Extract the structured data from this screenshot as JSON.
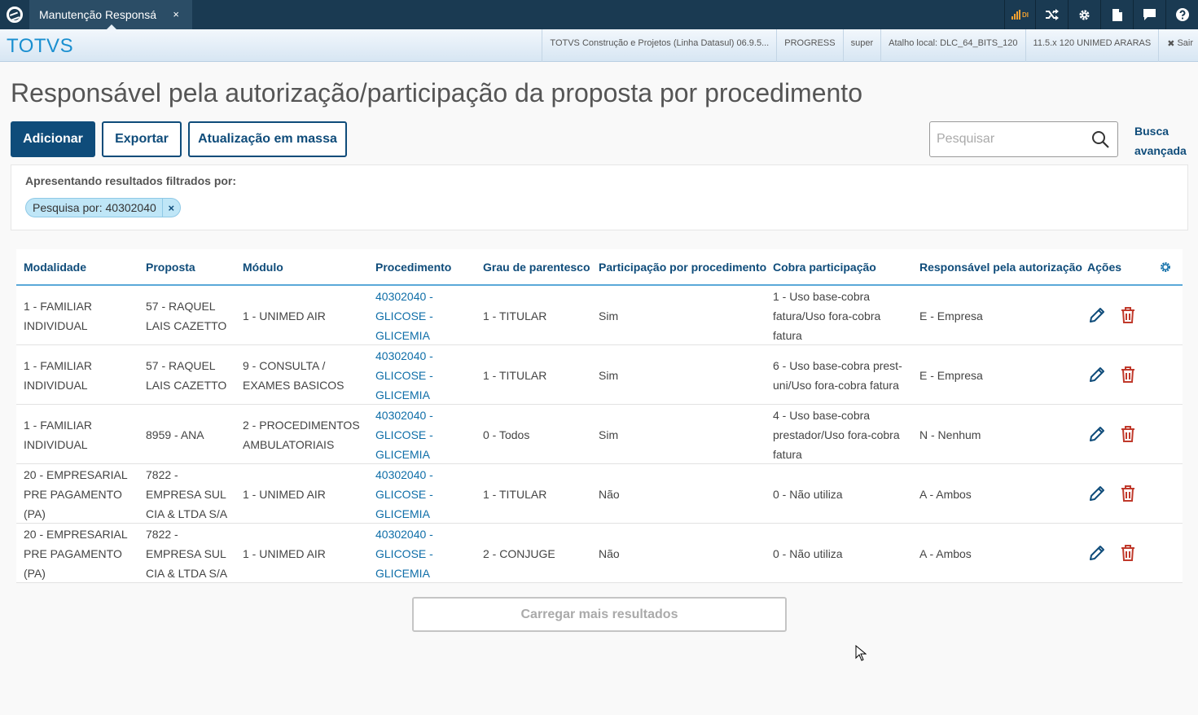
{
  "topbar": {
    "tab_title": "Manutenção Responsá",
    "tab_close": "×",
    "signal_label": "DI",
    "icons": [
      "signal-icon",
      "shuffle-icon",
      "gear-icon",
      "document-icon",
      "chat-icon",
      "help-icon"
    ]
  },
  "header": {
    "brand": "TOTVS",
    "info": [
      "TOTVS Construção e Projetos (Linha Datasul) 06.9.5...",
      "PROGRESS",
      "super",
      "Atalho local: DLC_64_BITS_120",
      "11.5.x 120 UNIMED ARARAS"
    ],
    "logout": "Sair"
  },
  "page": {
    "title": "Responsável pela autorização/participação da proposta por procedimento",
    "add_button": "Adicionar",
    "export_button": "Exportar",
    "mass_update_button": "Atualização em massa",
    "search_placeholder": "Pesquisar",
    "advanced_search": "Busca avançada"
  },
  "filter": {
    "label": "Apresentando resultados filtrados por:",
    "chip": "Pesquisa por: 40302040",
    "chip_close": "×"
  },
  "table": {
    "columns": [
      "Modalidade",
      "Proposta",
      "Módulo",
      "Procedimento",
      "Grau de parentesco",
      "Participação por procedimento",
      "Cobra participação",
      "Responsável pela autorização",
      "Ações"
    ],
    "rows": [
      {
        "modalidade": "1 - FAMILIAR INDIVIDUAL",
        "proposta": "57 - RAQUEL LAIS CAZETTO",
        "modulo": "1 - UNIMED AIR",
        "procedimento": "40302040 - GLICOSE - GLICEMIA",
        "grau": "1 - TITULAR",
        "participacao": "Sim",
        "cobra": "1 - Uso base-cobra fatura/Uso fora-cobra fatura",
        "responsavel": "E - Empresa"
      },
      {
        "modalidade": "1 - FAMILIAR INDIVIDUAL",
        "proposta": "57 - RAQUEL LAIS CAZETTO",
        "modulo": "9 - CONSULTA / EXAMES BASICOS",
        "procedimento": "40302040 - GLICOSE - GLICEMIA",
        "grau": "1 - TITULAR",
        "participacao": "Sim",
        "cobra": "6 - Uso base-cobra prest-uni/Uso fora-cobra fatura",
        "responsavel": "E - Empresa"
      },
      {
        "modalidade": "1 - FAMILIAR INDIVIDUAL",
        "proposta": "8959 - ANA",
        "modulo": "2 - PROCEDIMENTOS AMBULATORIAIS",
        "procedimento": "40302040 - GLICOSE - GLICEMIA",
        "grau": "0 - Todos",
        "participacao": "Sim",
        "cobra": "4 - Uso base-cobra prestador/Uso fora-cobra fatura",
        "responsavel": "N - Nenhum"
      },
      {
        "modalidade": "20 - EMPRESARIAL PRE PAGAMENTO (PA)",
        "proposta": "7822 - EMPRESA SUL CIA & LTDA S/A",
        "modulo": "1 - UNIMED AIR",
        "procedimento": "40302040 - GLICOSE - GLICEMIA",
        "grau": "1 - TITULAR",
        "participacao": "Não",
        "cobra": "0 - Não utiliza",
        "responsavel": "A - Ambos"
      },
      {
        "modalidade": "20 - EMPRESARIAL PRE PAGAMENTO (PA)",
        "proposta": "7822 - EMPRESA SUL CIA & LTDA S/A",
        "modulo": "1 - UNIMED AIR",
        "procedimento": "40302040 - GLICOSE - GLICEMIA",
        "grau": "2 - CONJUGE",
        "participacao": "Não",
        "cobra": "0 - Não utiliza",
        "responsavel": "A - Ambos"
      }
    ]
  },
  "load_more": "Carregar mais resultados",
  "colors": {
    "dark_nav": "#1a3a52",
    "primary": "#0f4c7a",
    "link": "#0f6ea8",
    "delete": "#c0392b",
    "chip": "#bfe6f7"
  }
}
